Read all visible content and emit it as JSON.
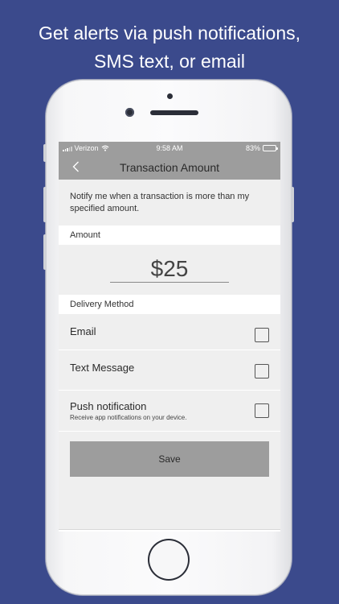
{
  "headline": {
    "line1": "Get alerts via push notifications,",
    "line2": "SMS text, or email"
  },
  "status_bar": {
    "carrier": "Verizon",
    "time": "9:58 AM",
    "battery": "83%",
    "battery_level": 0.83
  },
  "nav": {
    "back_icon": "chevron-left-icon",
    "title": "Transaction Amount"
  },
  "intro_text": "Notify me when a transaction is more than my specified amount.",
  "amount": {
    "section_label": "Amount",
    "value": "$25"
  },
  "delivery": {
    "section_label": "Delivery Method",
    "options": [
      {
        "label": "Email",
        "sublabel": "",
        "checked": false
      },
      {
        "label": "Text Message",
        "sublabel": "",
        "checked": false
      },
      {
        "label": "Push notification",
        "sublabel": "Receive app notifications on your device.",
        "checked": false
      }
    ]
  },
  "save_label": "Save",
  "colors": {
    "background": "#3b4a8c",
    "bar_gray": "#9d9d9d",
    "panel_gray": "#efefef"
  }
}
